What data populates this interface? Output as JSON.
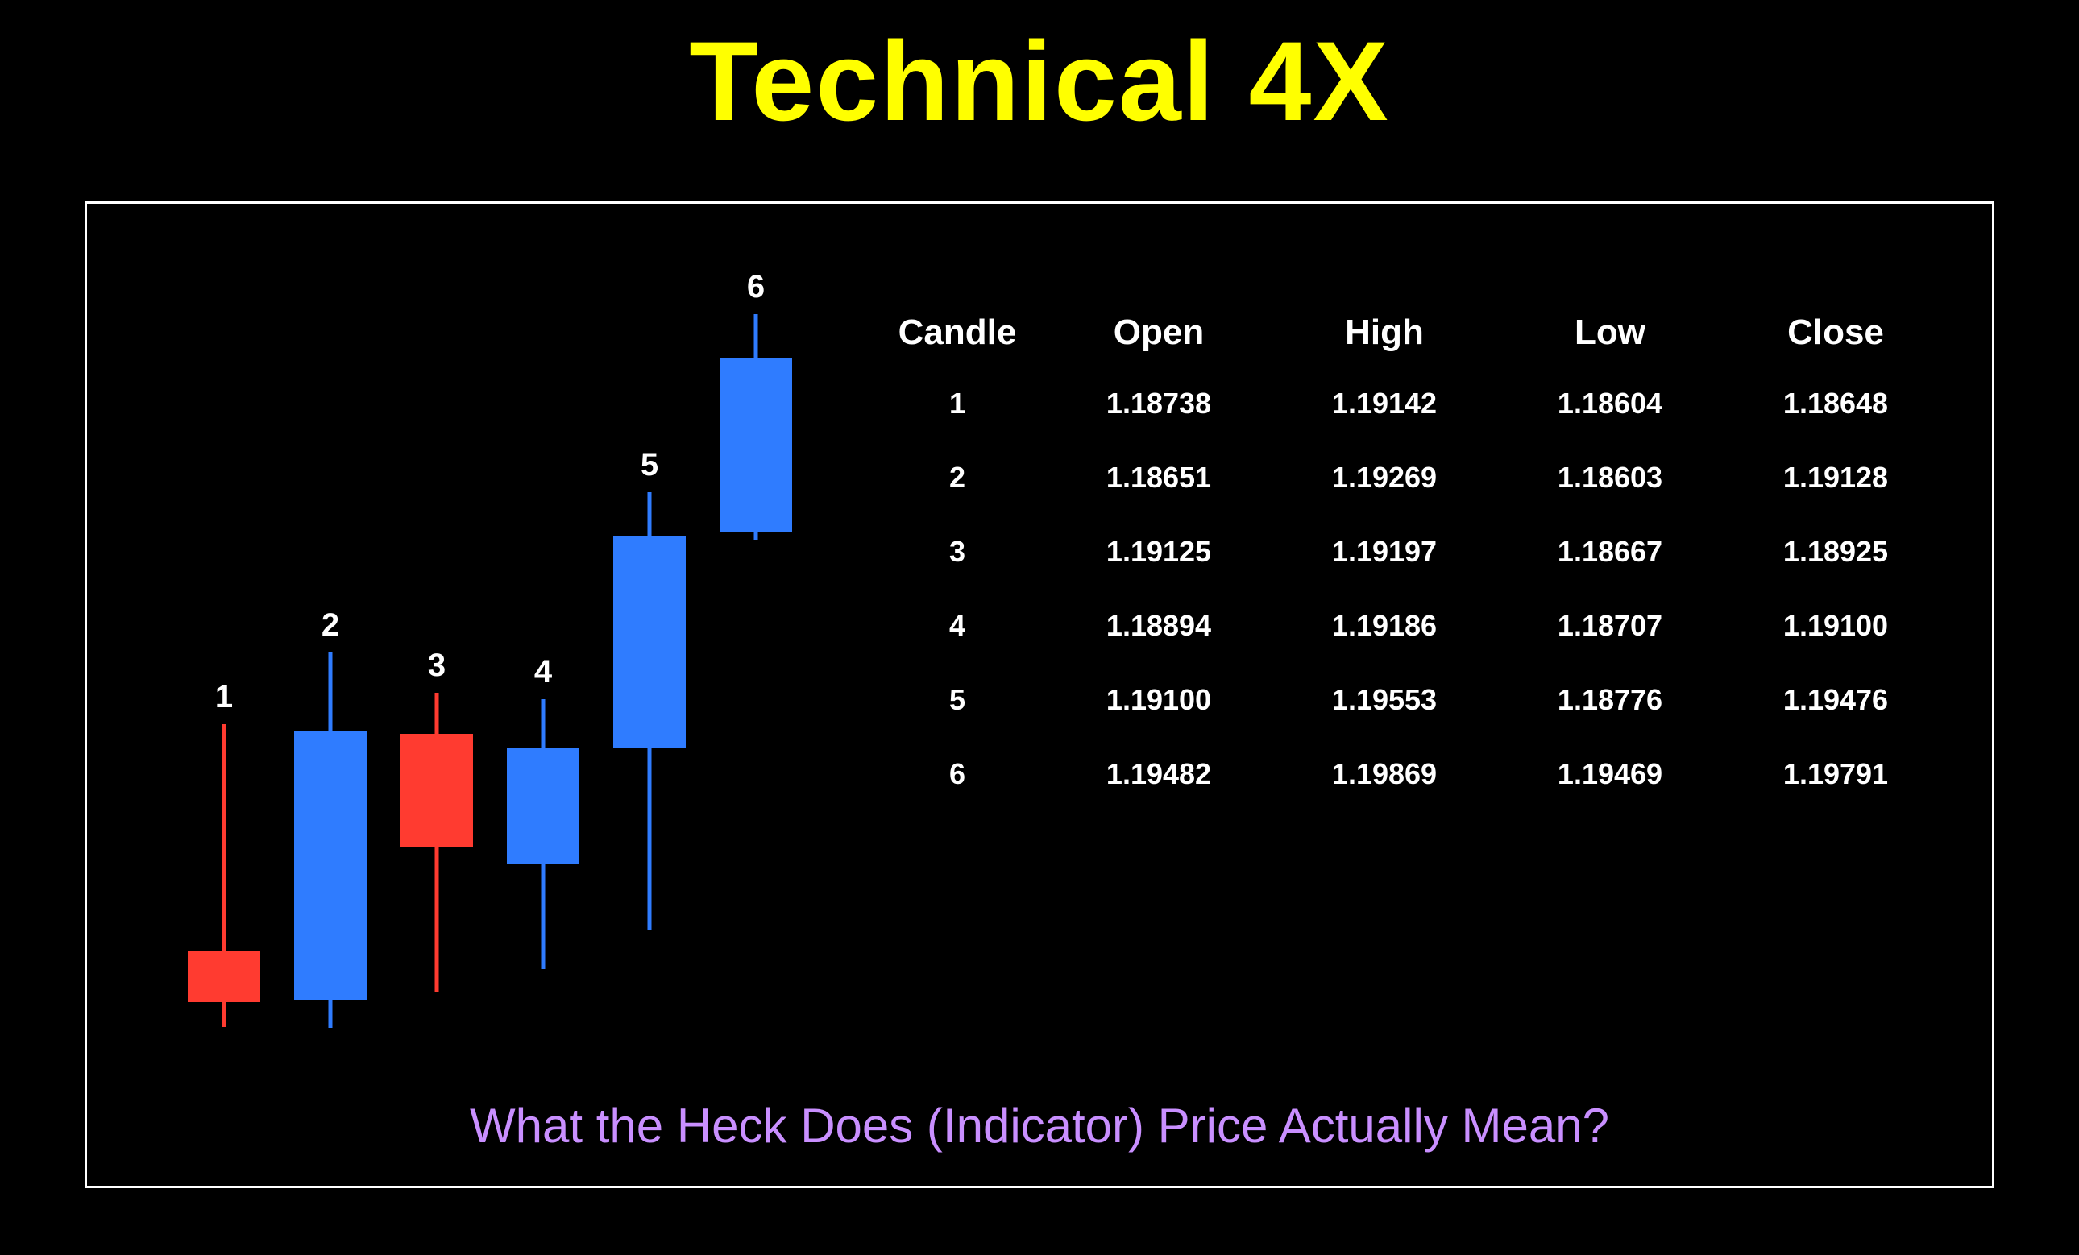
{
  "title": "Technical 4X",
  "subtitle": "What the Heck Does (Indicator) Price Actually Mean?",
  "table": {
    "headers": {
      "candle": "Candle",
      "open": "Open",
      "high": "High",
      "low": "Low",
      "close": "Close"
    },
    "rows": [
      {
        "candle": "1",
        "open": "1.18738",
        "high": "1.19142",
        "low": "1.18604",
        "close": "1.18648"
      },
      {
        "candle": "2",
        "open": "1.18651",
        "high": "1.19269",
        "low": "1.18603",
        "close": "1.19128"
      },
      {
        "candle": "3",
        "open": "1.19125",
        "high": "1.19197",
        "low": "1.18667",
        "close": "1.18925"
      },
      {
        "candle": "4",
        "open": "1.18894",
        "high": "1.19186",
        "low": "1.18707",
        "close": "1.19100"
      },
      {
        "candle": "5",
        "open": "1.19100",
        "high": "1.19553",
        "low": "1.18776",
        "close": "1.19476"
      },
      {
        "candle": "6",
        "open": "1.19482",
        "high": "1.19869",
        "low": "1.19469",
        "close": "1.19791"
      }
    ]
  },
  "chart_data": {
    "type": "candlestick",
    "title": "Candlestick OHLC",
    "xlabel": "",
    "ylabel": "",
    "colors": {
      "bull": "#2f7cff",
      "bear": "#ff3b30"
    },
    "series": [
      {
        "name": "1",
        "open": 1.18738,
        "high": 1.19142,
        "low": 1.18604,
        "close": 1.18648
      },
      {
        "name": "2",
        "open": 1.18651,
        "high": 1.19269,
        "low": 1.18603,
        "close": 1.19128
      },
      {
        "name": "3",
        "open": 1.19125,
        "high": 1.19197,
        "low": 1.18667,
        "close": 1.18925
      },
      {
        "name": "4",
        "open": 1.18894,
        "high": 1.19186,
        "low": 1.18707,
        "close": 1.191
      },
      {
        "name": "5",
        "open": 1.191,
        "high": 1.19553,
        "low": 1.18776,
        "close": 1.19476
      },
      {
        "name": "6",
        "open": 1.19482,
        "high": 1.19869,
        "low": 1.19469,
        "close": 1.19791
      }
    ],
    "ylim": [
      1.185,
      1.199
    ]
  }
}
